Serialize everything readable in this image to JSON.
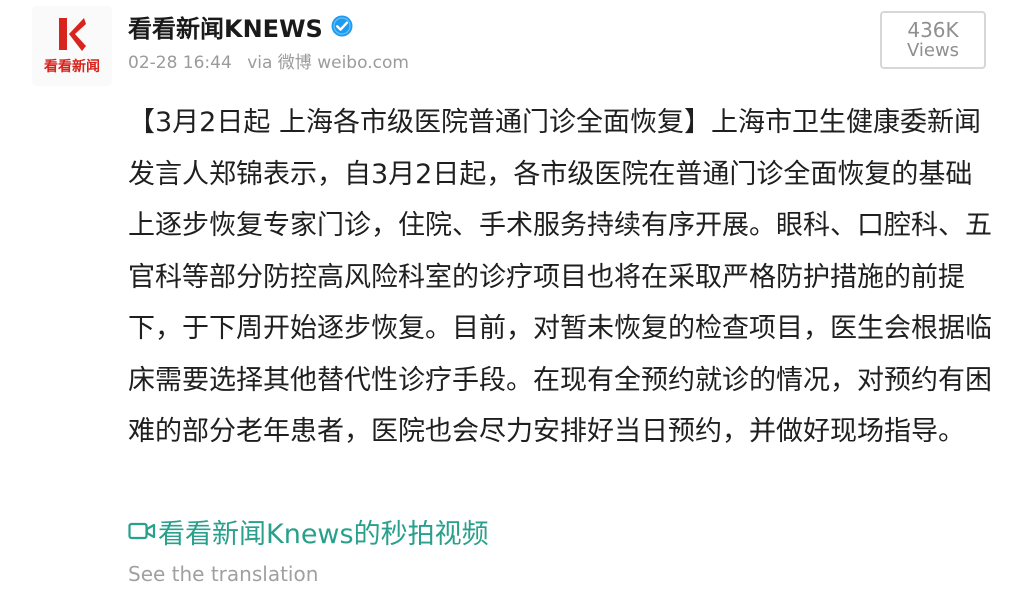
{
  "header": {
    "avatar_text": "看看新闻",
    "account_name": "看看新闻KNEWS",
    "timestamp": "02-28 16:44",
    "source": "via 微博 weibo.com",
    "views_count": "436K",
    "views_label": "Views"
  },
  "post": {
    "text": "【3月2日起 上海各市级医院普通门诊全面恢复】上海市卫生健康委新闻发言人郑锦表示，自3月2日起，各市级医院在普通门诊全面恢复的基础上逐步恢复专家门诊，住院、手术服务持续有序开展。眼科、口腔科、五官科等部分防控高风险科室的诊疗项目也将在采取严格防护措施的前提下，于下周开始逐步恢复。目前，对暂未恢复的检查项目，医生会根据临床需要选择其他替代性诊疗手段。在现有全预约就诊的情况，对预约有困难的部分老年患者，医院也会尽力安排好当日预约，并做好现场指导。",
    "video_link_label": "看看新闻Knews的秒拍视频",
    "translate_label": "See the translation"
  },
  "icons": {
    "avatar": "knews-logo-icon",
    "verified": "verified-badge-icon",
    "video": "video-camera-icon"
  },
  "colors": {
    "brand_red": "#d7241d",
    "verified_blue": "#1d9bf0",
    "link_green": "#28a08c",
    "muted_gray": "#9b9b9b"
  }
}
